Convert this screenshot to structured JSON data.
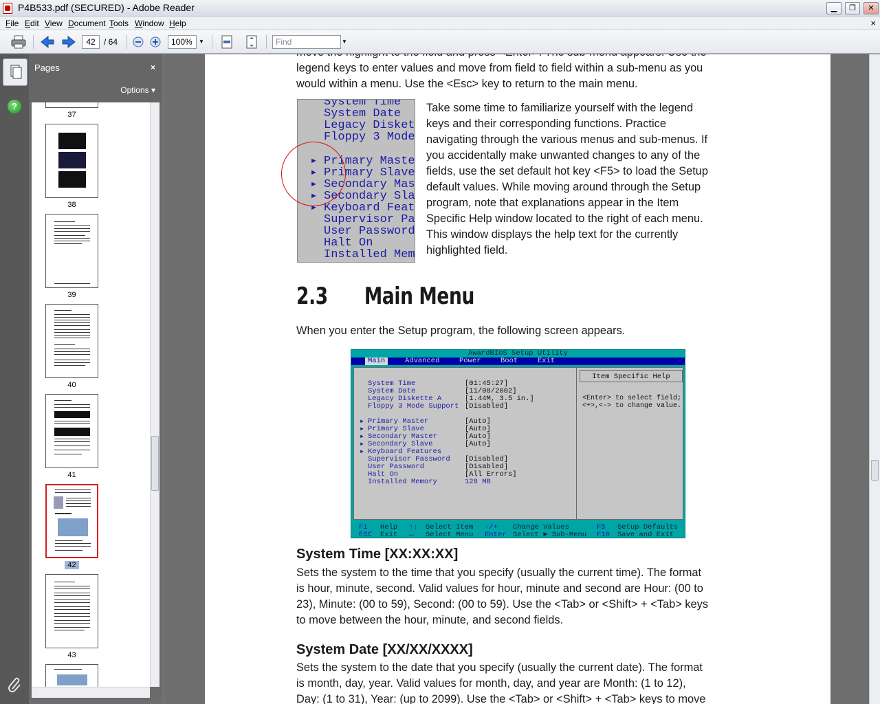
{
  "window": {
    "title": "P4B533.pdf (SECURED) - Adobe Reader",
    "minimize": "▁",
    "restore": "❐",
    "close": "✕"
  },
  "menu": {
    "items": [
      "File",
      "Edit",
      "View",
      "Document",
      "Tools",
      "Window",
      "Help"
    ],
    "close": "×"
  },
  "toolbar": {
    "current_page": "42",
    "page_total": "/ 64",
    "zoom": "100%",
    "find_placeholder": "Find"
  },
  "pages_panel": {
    "title": "Pages",
    "close": "×",
    "options": "Options ▾",
    "thumbnails": [
      {
        "label": "37"
      },
      {
        "label": "38"
      },
      {
        "label": "39"
      },
      {
        "label": "40"
      },
      {
        "label": "41"
      },
      {
        "label": "42",
        "selected": true
      },
      {
        "label": "43"
      }
    ]
  },
  "document": {
    "intro_lines": [
      "move the highlight to the field and press <Enter>. The sub-menu appears. Use the",
      "legend keys to enter values and move from field to field within a sub-menu as you",
      "would within a menu. Use the <Esc> key to return to the main menu."
    ],
    "float_lines": [
      "Take some time to familiarize yourself with the legend",
      "keys and their corresponding functions. Practice",
      "navigating through the various menus and sub-menus. If",
      "you accidentally make unwanted changes to any of the",
      "fields, use the set default hot key <F5> to load the Setup",
      "default values. While moving around through the Setup",
      "program, note that explanations appear in the Item",
      "Specific Help window located to the right of each menu.",
      "This window displays the help text for the currently",
      "highlighted field."
    ],
    "crop_rows": [
      "System Time",
      "System Date",
      "Legacy Diskett",
      "Floppy 3 Mode",
      "Primary Master",
      "Primary Slave",
      "Secondary Mast",
      "Secondary Slav",
      "Keyboard Featu",
      "Supervisor Pas",
      "User Password",
      "Halt On",
      "Installed Memo"
    ],
    "section_heading": "2.3      Main Menu",
    "section_intro": "When you enter the Setup program, the following screen appears.",
    "bios": {
      "title": "AwardBIOS Setup Utility",
      "menu": [
        "Main",
        "Advanced",
        "Power",
        "Boot",
        "Exit"
      ],
      "rows": [
        {
          "label": "System Time",
          "value": "[01:45:27]"
        },
        {
          "label": "System Date",
          "value": "[11/08/2002]"
        },
        {
          "label": "Legacy Diskette A",
          "value": "[1.44M, 3.5 in.]"
        },
        {
          "label": "Floppy 3 Mode Support",
          "value": "[Disabled]"
        },
        {
          "label": "Primary Master",
          "value": "[Auto]",
          "sub": true
        },
        {
          "label": "Primary Slave",
          "value": "[Auto]",
          "sub": true
        },
        {
          "label": "Secondary Master",
          "value": "[Auto]",
          "sub": true
        },
        {
          "label": "Secondary Slave",
          "value": "[Auto]",
          "sub": true
        },
        {
          "label": "Keyboard Features",
          "value": "",
          "sub": true
        },
        {
          "label": "Supervisor Password",
          "value": "[Disabled]"
        },
        {
          "label": "User Password",
          "value": "[Disabled]"
        },
        {
          "label": "Halt On",
          "value": "[All Errors]"
        },
        {
          "label": "Installed Memory",
          "value": "128 MB"
        }
      ],
      "help_title": "Item Specific Help",
      "help_lines": [
        "<Enter> to select field;",
        "<+>,<-> to change value."
      ],
      "footer": [
        [
          "F1",
          "Help",
          "↑↓",
          "Select Item",
          "-/+",
          "Change Values",
          "F5",
          "Setup Defaults"
        ],
        [
          "ESC",
          "Exit",
          "↔",
          "Select Menu",
          "Enter",
          "Select ► Sub-Menu",
          "F10",
          "Save and Exit"
        ]
      ]
    },
    "system_time_heading": "System Time [XX:XX:XX]",
    "system_time_lines": [
      "Sets the system to the time that you specify (usually the current time). The format",
      "is hour, minute, second. Valid values for hour, minute and second are Hour: (00 to",
      "23), Minute: (00 to 59), Second: (00 to 59). Use the <Tab> or <Shift> + <Tab> keys",
      "to move between the hour, minute, and second fields."
    ],
    "system_date_heading": "System Date [XX/XX/XXXX]",
    "system_date_lines": [
      "Sets the system to the date that you specify (usually the current date). The format",
      "is month, day, year. Valid values for month, day, and year are Month: (1 to 12),",
      "Day: (1 to 31), Year: (up to 2099). Use the <Tab> or <Shift> + <Tab> keys to move"
    ]
  }
}
